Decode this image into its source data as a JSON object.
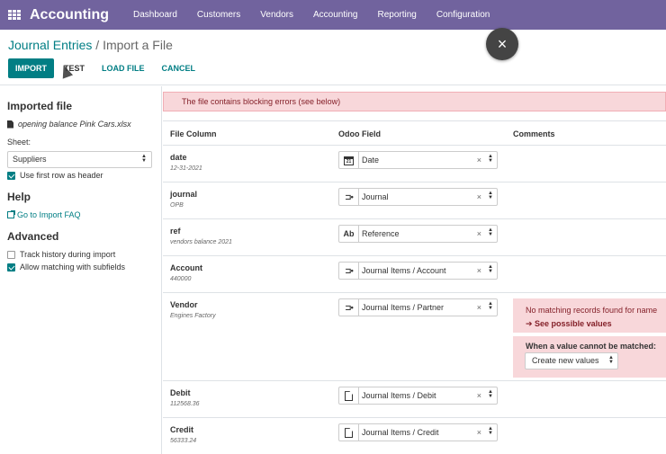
{
  "navbar": {
    "app_name": "Accounting",
    "menu": [
      "Dashboard",
      "Customers",
      "Vendors",
      "Accounting",
      "Reporting",
      "Configuration"
    ]
  },
  "breadcrumb": {
    "parent": "Journal Entries",
    "separator": "/",
    "current": "Import a File"
  },
  "buttons": {
    "import": "IMPORT",
    "test": "TEST",
    "load_file": "LOAD FILE",
    "cancel": "CANCEL"
  },
  "close_label": "×",
  "sidebar": {
    "imported_file_heading": "Imported file",
    "file_name": "opening balance Pink Cars.xlsx",
    "sheet_label": "Sheet:",
    "sheet_value": "Suppliers",
    "use_first_row": "Use first row as header",
    "help_heading": "Help",
    "faq_link": "Go to Import FAQ",
    "advanced_heading": "Advanced",
    "track_history": "Track history during import",
    "allow_matching": "Allow matching with subfields"
  },
  "alert": "The file contains blocking errors (see below)",
  "table": {
    "headers": {
      "file_column": "File Column",
      "odoo_field": "Odoo Field",
      "comments": "Comments"
    },
    "rows": [
      {
        "name": "date",
        "sample": "12-31-2021",
        "icon": "calendar-icon",
        "field": "Date"
      },
      {
        "name": "journal",
        "sample": "OPB",
        "icon": "relation-icon",
        "field": "Journal"
      },
      {
        "name": "ref",
        "sample": "vendors balance 2021",
        "icon": "text-icon",
        "icon_text": "Ab",
        "field": "Reference"
      },
      {
        "name": "Account",
        "sample": "440000",
        "icon": "relation-icon",
        "field": "Journal Items / Account"
      },
      {
        "name": "Vendor",
        "sample": "Engines Factory",
        "icon": "relation-icon",
        "field": "Journal Items / Partner"
      },
      {
        "name": "Debit",
        "sample": "112568.36",
        "icon": "document-icon",
        "field": "Journal Items / Debit"
      },
      {
        "name": "Credit",
        "sample": "56333.24",
        "icon": "document-icon",
        "field": "Journal Items / Credit"
      }
    ],
    "clear_symbol": "×"
  },
  "vendor_comment": {
    "message": "No matching records found for name",
    "link": "See possible values",
    "unmatched_title": "When a value cannot be matched:",
    "unmatched_value": "Create new values"
  }
}
